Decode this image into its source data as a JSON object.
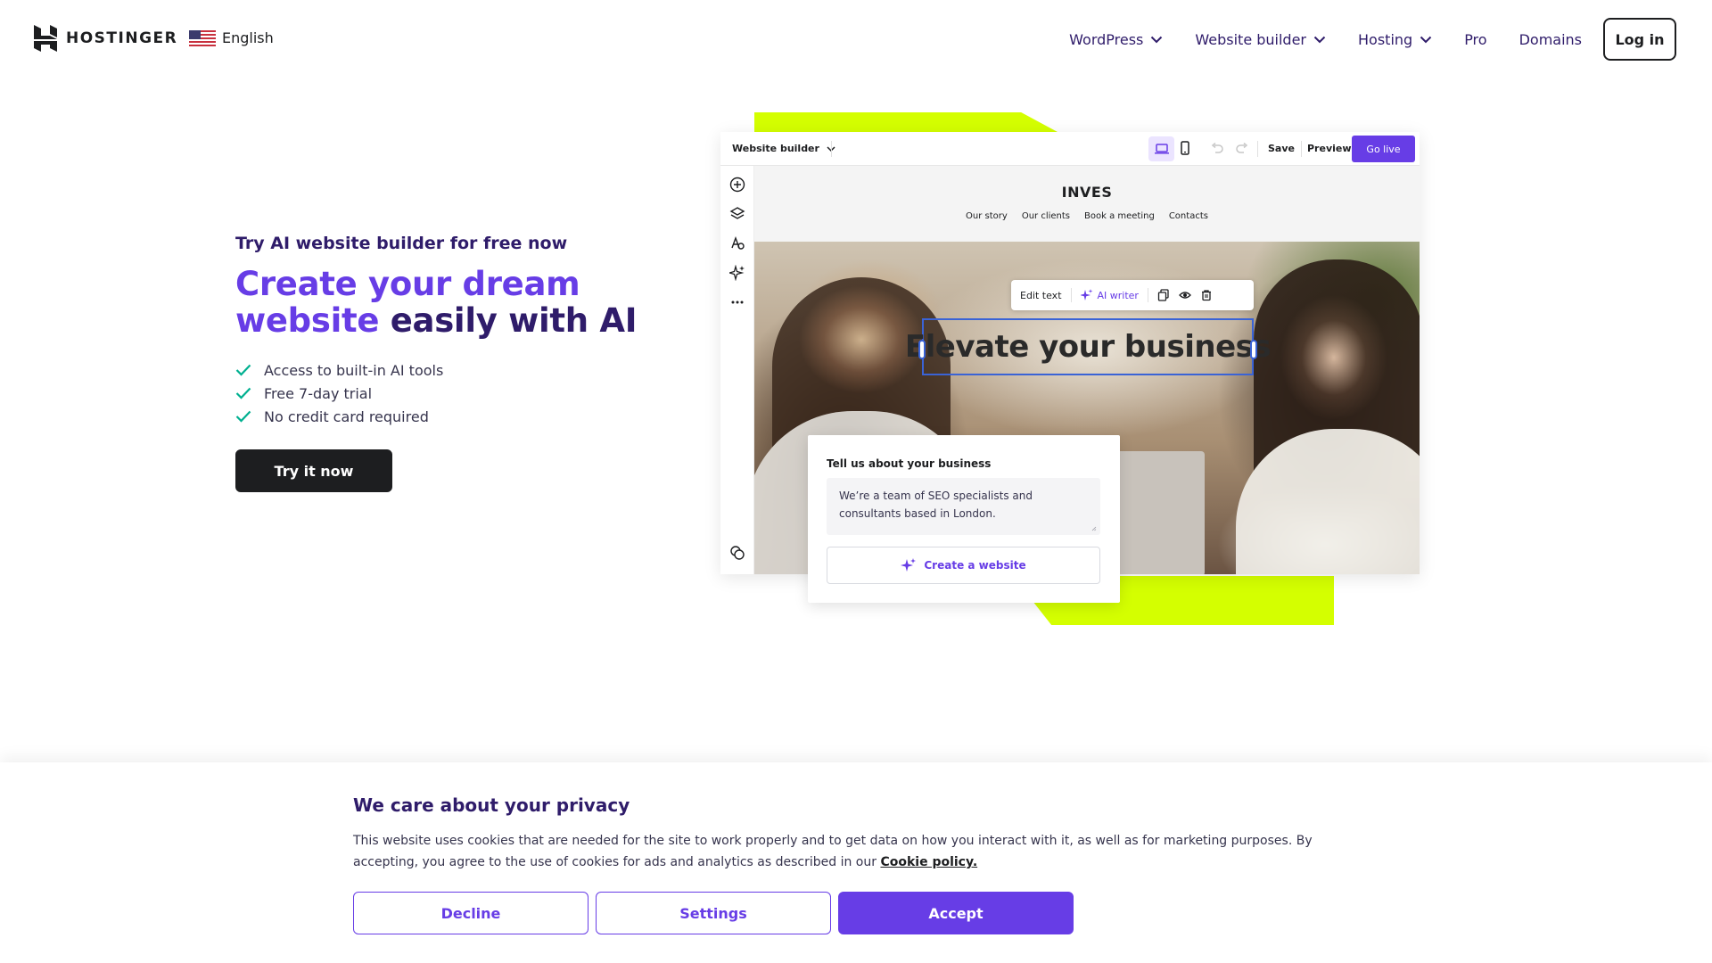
{
  "header": {
    "brand": "HOSTINGER",
    "language": "English",
    "nav": [
      {
        "label": "WordPress",
        "has_dropdown": true
      },
      {
        "label": "Website builder",
        "has_dropdown": true
      },
      {
        "label": "Hosting",
        "has_dropdown": true
      },
      {
        "label": "Pro",
        "has_dropdown": false
      },
      {
        "label": "Domains",
        "has_dropdown": false
      }
    ],
    "login_label": "Log in"
  },
  "hero": {
    "eyebrow": "Try AI website builder for free now",
    "headline_accent": "Create your dream website",
    "headline_rest": "easily with AI",
    "features": [
      "Access to built-in AI tools",
      "Free 7-day trial",
      "No credit card required"
    ],
    "cta_label": "Try it now"
  },
  "builder": {
    "title": "Website builder",
    "save_label": "Save",
    "preview_label": "Preview",
    "golive_label": "Go live",
    "site": {
      "brand": "INVES",
      "links": [
        "Our story",
        "Our clients",
        "Book a meeting",
        "Contacts"
      ],
      "headline": "Elevate your business"
    },
    "edit_toolbar": {
      "edit_text": "Edit text",
      "ai_writer": "AI writer"
    },
    "ai_card": {
      "title": "Tell us about your business",
      "text": "We’re a team of SEO specialists and consultants based in London.",
      "button": "Create a website"
    }
  },
  "cookie": {
    "title": "We care about your privacy",
    "text": "This website uses cookies that are needed for the site to work properly and to get data on how you interact with it, as well as for marketing purposes. By accepting, you agree to the use of cookies for ads and analytics as described in our",
    "link": "Cookie policy.",
    "decline": "Decline",
    "settings": "Settings",
    "accept": "Accept"
  },
  "colors": {
    "accent": "#673de6",
    "dark": "#1d1e20",
    "navy": "#2f1c6a",
    "lime": "#d4ff00",
    "check": "#00b090"
  }
}
